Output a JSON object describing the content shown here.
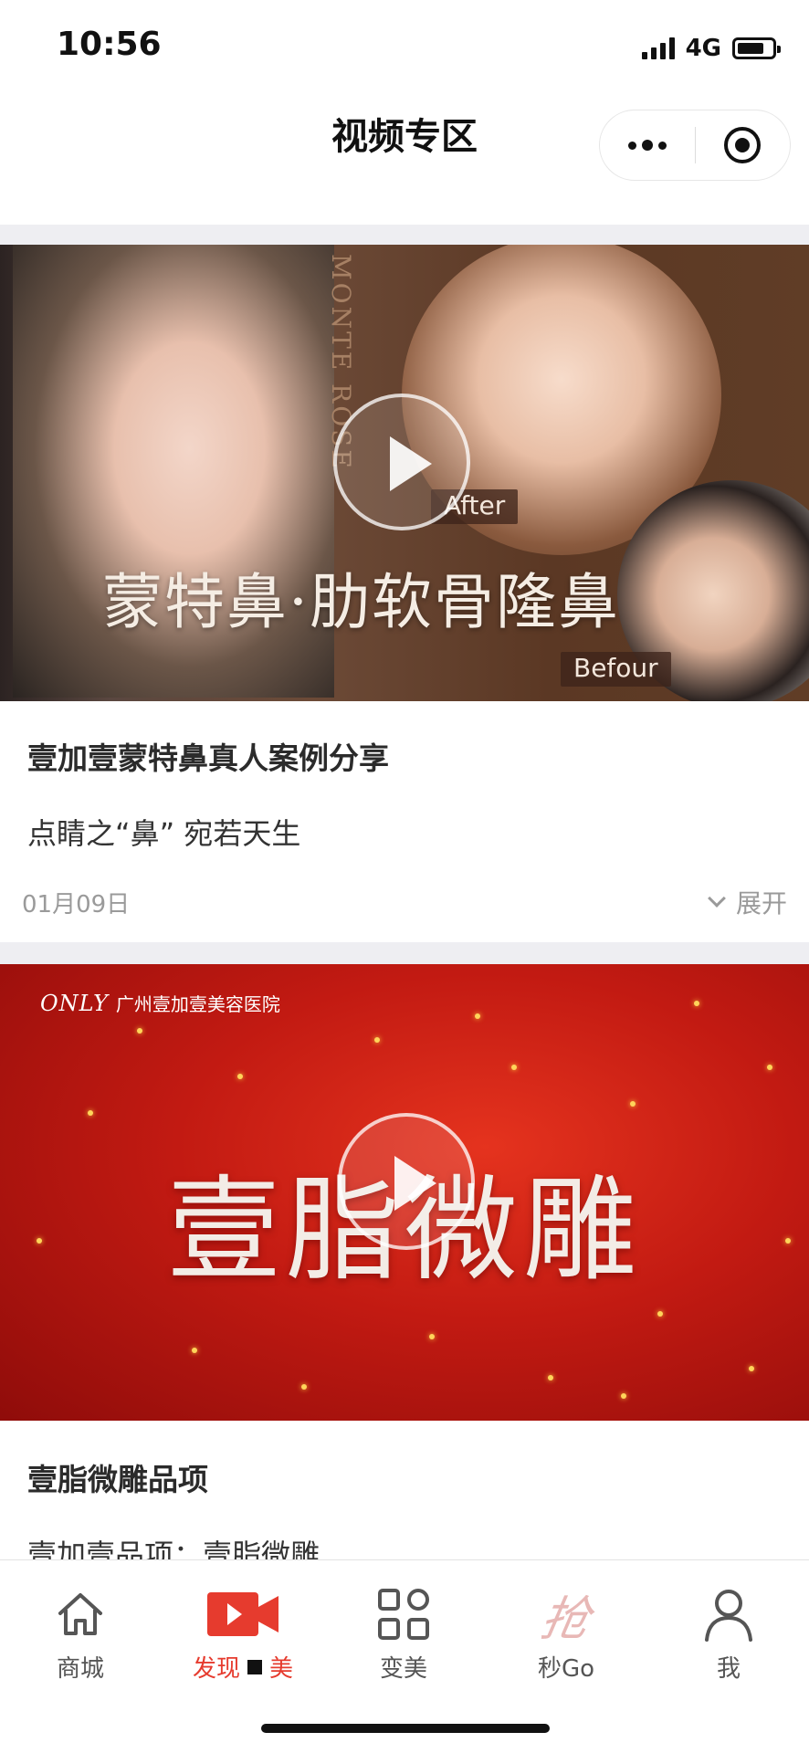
{
  "status": {
    "time": "10:56",
    "network": "4G"
  },
  "nav": {
    "title": "视频专区"
  },
  "cards": [
    {
      "video": {
        "side_text": "MONTE ROSE",
        "headline": "蒙特鼻·肋软骨隆鼻",
        "tag_after": "After",
        "tag_before": "Befour"
      },
      "title": "壹加壹蒙特鼻真人案例分享",
      "subtitle": "点睛之“鼻” 宛若天生",
      "date": "01月09日",
      "expand_label": "展开"
    },
    {
      "video": {
        "logo_script": "ONLY",
        "logo_name": "广州壹加壹美容医院",
        "big_title": "壹脂微雕"
      },
      "title": "壹脂微雕品项",
      "subtitle": "壹加壹品项：壹脂微雕"
    }
  ],
  "tabbar": {
    "items": [
      {
        "label": "商城",
        "icon": "home-icon"
      },
      {
        "label": "发现",
        "label_suffix": "美",
        "icon": "video-camera-icon",
        "active": true
      },
      {
        "label": "变美",
        "icon": "grid-icon"
      },
      {
        "label": "秒Go",
        "icon_glyph": "抢",
        "icon": "flash-sale-icon"
      },
      {
        "label": "我",
        "icon": "user-icon"
      }
    ],
    "active_color": "#e63b2e"
  }
}
